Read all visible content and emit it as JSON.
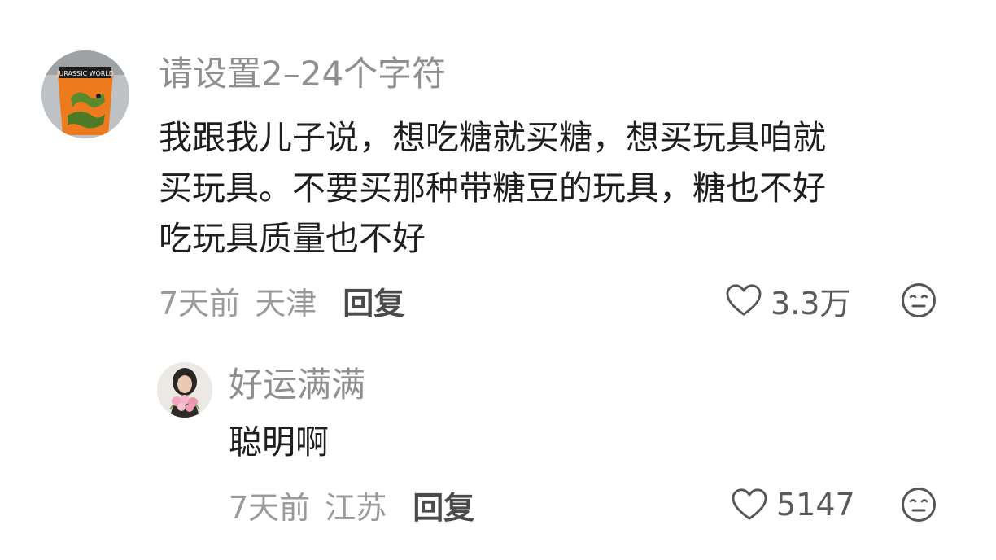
{
  "comments": [
    {
      "username": "请设置2–24个字符",
      "lines": [
        "我跟我儿子说，想吃糖就买糖，想买玩具咱就",
        "买玩具。不要买那种带糖豆的玩具，糖也不好",
        "吃玩具质量也不好"
      ],
      "time": "7天前",
      "location": "天津",
      "reply_label": "回复",
      "likes": "3.3万",
      "avatar_icon": "orange-cup-avatar",
      "avatar_logo_text": "JURASSIC WORLD"
    },
    {
      "username": "好运满满",
      "lines": [
        "聪明啊"
      ],
      "time": "7天前",
      "location": "江苏",
      "reply_label": "回复",
      "likes": "5147",
      "avatar_icon": "person-with-flowers-avatar"
    }
  ],
  "icons": {
    "like": "heart-outline-icon",
    "react": "neutral-face-icon"
  },
  "colors": {
    "username": "#8f8f8f",
    "text": "#1e1e1e",
    "meta": "#9a9a9a",
    "icon": "#555555"
  }
}
